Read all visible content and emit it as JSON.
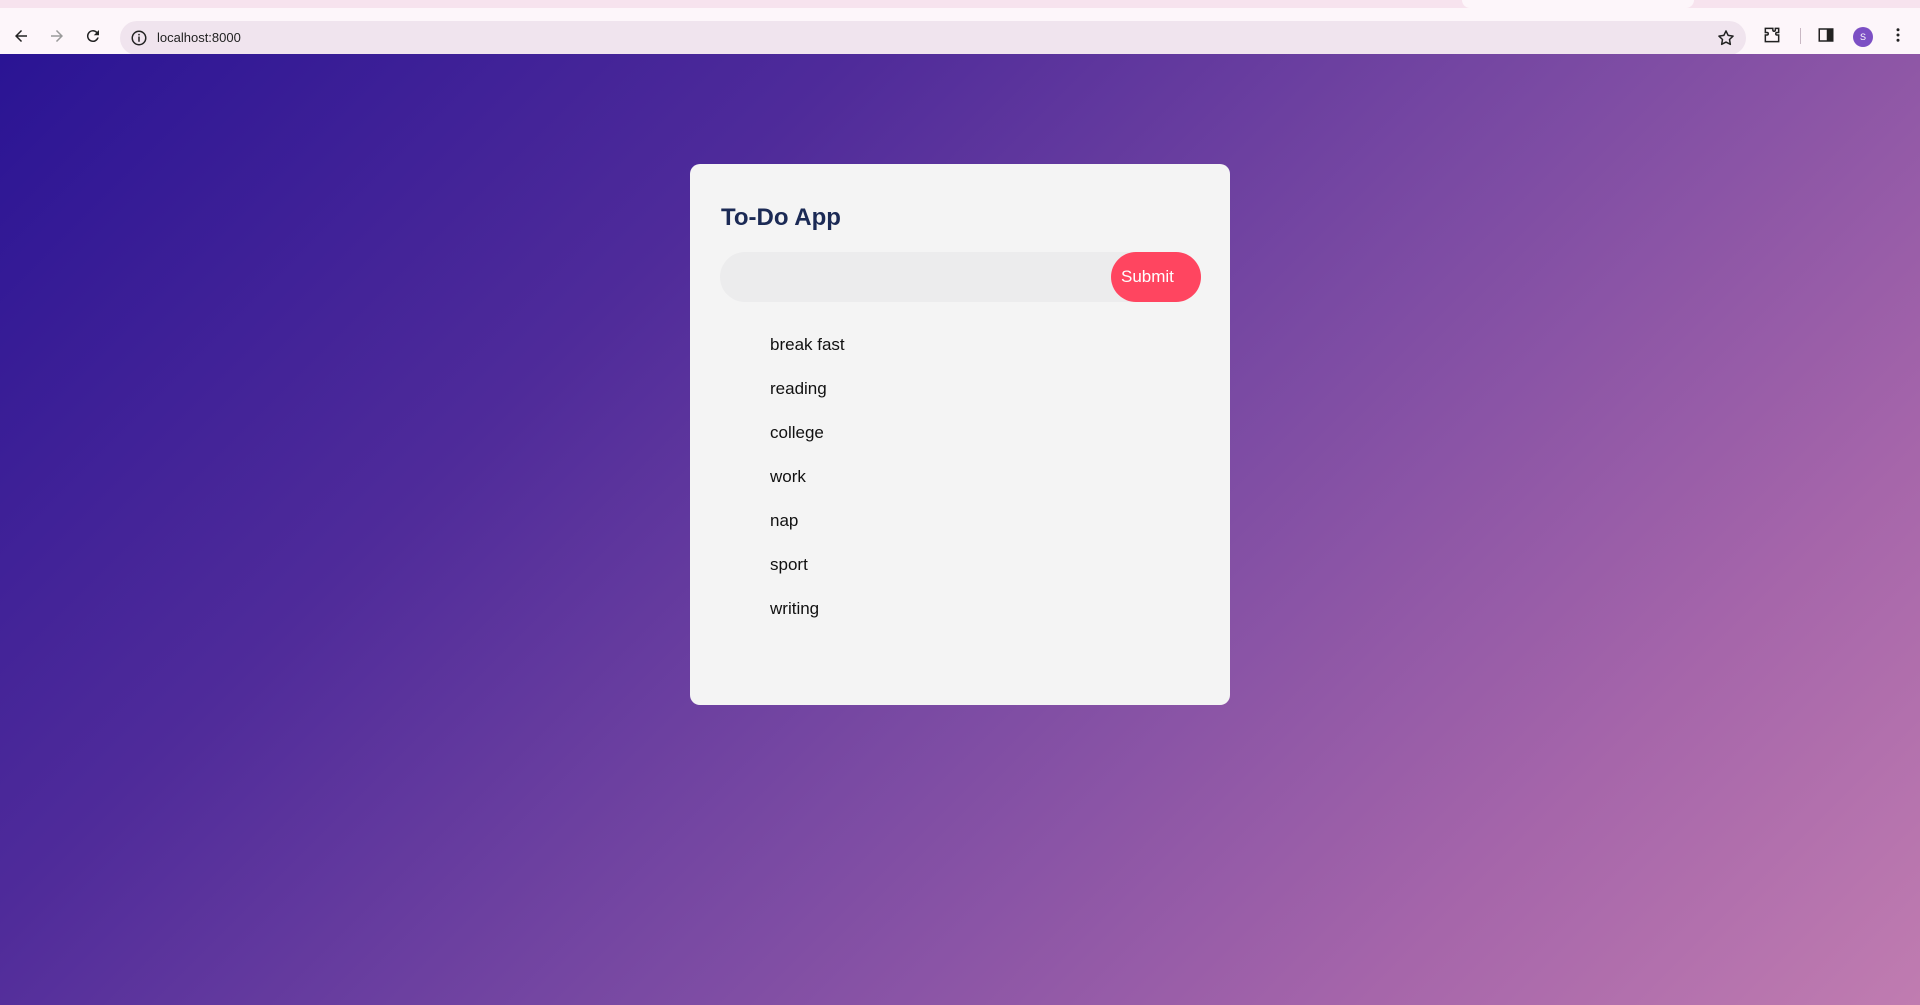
{
  "browser": {
    "url": "localhost:8000",
    "profile_initial": "S",
    "icons": [
      "back-arrow-icon",
      "forward-arrow-icon",
      "reload-icon",
      "site-info-icon",
      "bookmark-star-icon",
      "extensions-icon",
      "side-panel-icon",
      "menu-dots-icon"
    ]
  },
  "app": {
    "title": "To-Do App",
    "input": {
      "value": "",
      "placeholder": ""
    },
    "submit_label": "Submit",
    "tasks": [
      "break fast",
      "reading",
      "college",
      "work",
      "nap",
      "sport",
      "writing"
    ]
  },
  "colors": {
    "gradient_start": "#2a1494",
    "gradient_end": "#c07cb0",
    "card_bg": "#f4f4f4",
    "title": "#1b2a55",
    "submit_bg": "#ff4560"
  }
}
